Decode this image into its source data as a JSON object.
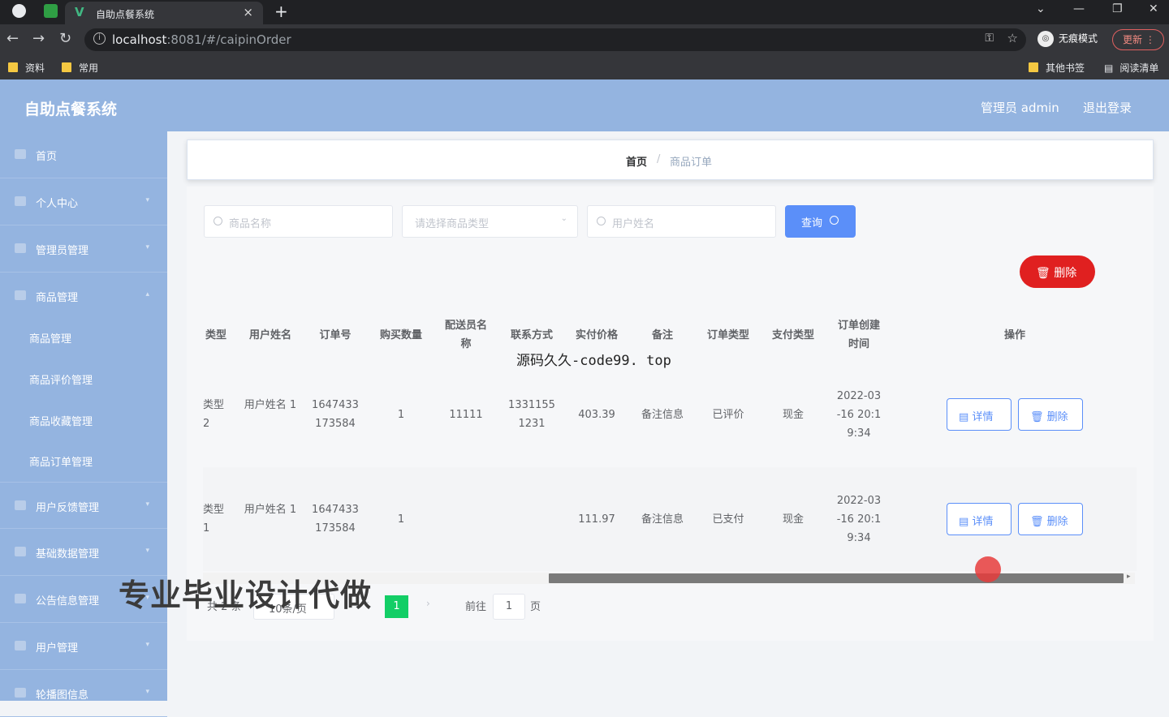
{
  "browser": {
    "tab_title": "自助点餐系统",
    "url_host": "localhost",
    "url_rest": ":8081/#/caipinOrder",
    "incognito": "无痕模式",
    "update": "更新",
    "bookmarks": [
      "资料",
      "常用"
    ],
    "bookmarks_right": [
      "其他书签",
      "阅读清单"
    ]
  },
  "header": {
    "title": "自助点餐系统",
    "admin": "管理员 admin",
    "logout": "退出登录"
  },
  "sidebar": {
    "items": [
      {
        "label": "首页"
      },
      {
        "label": "个人中心"
      },
      {
        "label": "管理员管理"
      },
      {
        "label": "商品管理"
      }
    ],
    "sub_items": [
      "商品管理",
      "商品评价管理",
      "商品收藏管理",
      "商品订单管理"
    ],
    "items2": [
      {
        "label": "用户反馈管理"
      },
      {
        "label": "基础数据管理"
      },
      {
        "label": "公告信息管理"
      },
      {
        "label": "用户管理"
      },
      {
        "label": "轮播图信息"
      }
    ]
  },
  "breadcrumb": {
    "home": "首页",
    "sep": "/",
    "current": "商品订单"
  },
  "search": {
    "name_placeholder": "商品名称",
    "type_placeholder": "请选择商品类型",
    "user_placeholder": "用户姓名",
    "query_label": "查询"
  },
  "actions": {
    "delete_label": "删除"
  },
  "table": {
    "headers": [
      "类型",
      "用户姓名",
      "订单号",
      "购买数量",
      "配送员名称",
      "联系方式",
      "实付价格",
      "备注",
      "订单类型",
      "支付类型",
      "订单创建时间",
      "操作"
    ],
    "rows": [
      {
        "type": "类型 2",
        "user": "用户姓名 1",
        "order_no": "1647433 173584",
        "qty": "1",
        "courier": "11111",
        "phone": "1331155 1231",
        "price": "403.39",
        "note": "备注信息",
        "order_type": "已评价",
        "pay_type": "现金",
        "created": "2022-03 -16 20:1 9:34"
      },
      {
        "type": "类型 1",
        "user": "用户姓名 1",
        "order_no": "1647433 173584",
        "qty": "1",
        "courier": "",
        "phone": "",
        "price": "111.97",
        "note": "备注信息",
        "order_type": "已支付",
        "pay_type": "现金",
        "created": "2022-03 -16 20:1 9:34"
      }
    ],
    "detail_label": "详情",
    "row_delete_label": "删除"
  },
  "pagination": {
    "total": "共 2 条",
    "size": "10条/页",
    "current": "1",
    "goto": "前往",
    "page_value": "1",
    "page_unit": "页"
  },
  "overlay": {
    "watermark": "源码久久-code99. top",
    "banner": "专业毕业设计代做"
  }
}
